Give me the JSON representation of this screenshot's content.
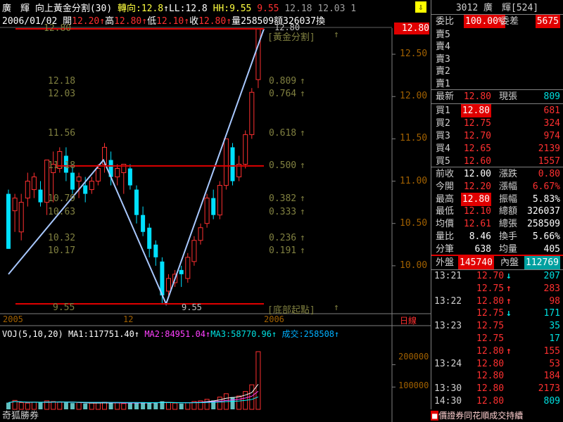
{
  "header": {
    "stock_name": "廣　輝",
    "indicator": "向上黃金分割(30)",
    "turn_label": "轉向:",
    "turn_value": "12.8",
    "ll_label": "↑LL:",
    "ll_value": "12.8",
    "hh_label": "HH:",
    "hh_value": "9.55",
    "level_a": "9.55",
    "level_b": "12.18",
    "level_c": "12.03",
    "level_d": "1",
    "date": "2006/01/02",
    "open_label": "開",
    "open": "12.20↑",
    "high_label": "高",
    "high": "12.80↑",
    "low_label": "低",
    "low": "12.10↑",
    "close_label": "收",
    "close": "12.80↑",
    "vol_label": "量",
    "vol": "258509",
    "amt_label": "額",
    "amt": "326037",
    "turnover_label": "換"
  },
  "price_axis": {
    "ticks": [
      "12.50",
      "12.00",
      "11.50",
      "11.00",
      "10.50",
      "10.00"
    ],
    "current_marker": "12.80"
  },
  "fib_labels": {
    "top": "12.80",
    "top_tag": "[黃金分割]",
    "bottom": "9.55",
    "bottom_tag": "[底部起點]",
    "arrow": "↑",
    "levels": [
      {
        "price": "12.18",
        "ratio": "0.809"
      },
      {
        "price": "12.03",
        "ratio": "0.764"
      },
      {
        "price": "11.56",
        "ratio": "0.618"
      },
      {
        "price": "11.18",
        "ratio": "0.500"
      },
      {
        "price": "10.79",
        "ratio": "0.382"
      },
      {
        "price": "10.63",
        "ratio": "0.333"
      },
      {
        "price": "10.32",
        "ratio": "0.236"
      },
      {
        "price": "10.17",
        "ratio": "0.191"
      }
    ],
    "right_arrows": [
      "↑",
      "↑",
      "↑",
      "↑",
      "↑",
      "↑",
      "↑",
      "↑"
    ]
  },
  "date_axis": {
    "left": "2005",
    "mid": "12",
    "right": "2006",
    "period": "日線"
  },
  "volume": {
    "title": "VOJ(5,10,20)",
    "ma1_label": "MA1:",
    "ma1": "117751.40↑",
    "ma2_label": "MA2:",
    "ma2": "84951.04↑",
    "ma3_label": "MA3:",
    "ma3": "58770.96↑",
    "deal_label": "成交:",
    "deal": "258508↑",
    "axis": [
      "200000",
      "100000"
    ],
    "watermark": "奇狐勝券"
  },
  "quote": {
    "code_name": "3012 廣　輝[524]",
    "wei_bi_label": "委比",
    "wei_bi": "100.00%",
    "wei_cha_label": "委差",
    "wei_cha": "5675",
    "sells": [
      "賣5",
      "賣4",
      "賣3",
      "賣2",
      "賣1"
    ],
    "last_label": "最新",
    "last": "12.80",
    "now_vol_label": "現張",
    "now_vol": "809",
    "buys": [
      {
        "label": "買1",
        "price": "12.80",
        "vol": "681"
      },
      {
        "label": "買2",
        "price": "12.75",
        "vol": "324"
      },
      {
        "label": "買3",
        "price": "12.70",
        "vol": "974"
      },
      {
        "label": "買4",
        "price": "12.65",
        "vol": "2139"
      },
      {
        "label": "買5",
        "price": "12.60",
        "vol": "1557"
      }
    ],
    "stats": [
      {
        "l1": "前收",
        "v1": "12.00",
        "l2": "漲跌",
        "v2": "0.80",
        "c1": "wht",
        "c2": "red"
      },
      {
        "l1": "今開",
        "v1": "12.20",
        "l2": "漲幅",
        "v2": "6.67%",
        "c1": "red",
        "c2": "red"
      },
      {
        "l1": "最高",
        "v1": "12.80",
        "l2": "振幅",
        "v2": "5.83%",
        "c1": "hl",
        "c2": "wht"
      },
      {
        "l1": "最低",
        "v1": "12.10",
        "l2": "總額",
        "v2": "326037",
        "c1": "red",
        "c2": "wht"
      },
      {
        "l1": "均價",
        "v1": "12.61",
        "l2": "總張",
        "v2": "258509",
        "c1": "red",
        "c2": "wht"
      },
      {
        "l1": "量比",
        "v1": "8.46",
        "l2": "換手",
        "v2": "5.66%",
        "c1": "wht",
        "c2": "wht"
      },
      {
        "l1": "分筆",
        "v1": "638",
        "l2": "均量",
        "v2": "405",
        "c1": "wht",
        "c2": "wht"
      }
    ],
    "outer_label": "外盤",
    "outer": "145740",
    "inner_label": "內盤",
    "inner": "112769",
    "ticks": [
      {
        "t": "13:21",
        "p": "12.70",
        "a": "↓",
        "v": "207",
        "pc": "red",
        "ac": "cyn",
        "vc": "cyn"
      },
      {
        "t": "",
        "p": "12.75",
        "a": "↑",
        "v": "283",
        "pc": "red",
        "ac": "red",
        "vc": "red"
      },
      {
        "t": "13:22",
        "p": "12.80",
        "a": "↑",
        "v": "98",
        "pc": "red",
        "ac": "red",
        "vc": "red"
      },
      {
        "t": "",
        "p": "12.75",
        "a": "↓",
        "v": "171",
        "pc": "red",
        "ac": "cyn",
        "vc": "cyn"
      },
      {
        "t": "13:23",
        "p": "12.75",
        "a": "",
        "v": "35",
        "pc": "red",
        "ac": "cyn",
        "vc": "cyn"
      },
      {
        "t": "",
        "p": "12.75",
        "a": "",
        "v": "17",
        "pc": "red",
        "ac": "cyn",
        "vc": "cyn"
      },
      {
        "t": "",
        "p": "12.80",
        "a": "↑",
        "v": "155",
        "pc": "red",
        "ac": "red",
        "vc": "red"
      },
      {
        "t": "13:24",
        "p": "12.80",
        "a": "",
        "v": "53",
        "pc": "red",
        "ac": "red",
        "vc": "red"
      },
      {
        "t": "",
        "p": "12.80",
        "a": "",
        "v": "184",
        "pc": "red",
        "ac": "red",
        "vc": "red"
      },
      {
        "t": "13:30",
        "p": "12.80",
        "a": "",
        "v": "2173",
        "pc": "red",
        "ac": "red",
        "vc": "red"
      },
      {
        "t": "14:30",
        "p": "12.80",
        "a": "",
        "v": "809",
        "pc": "red",
        "ac": "cyn",
        "vc": "cyn"
      }
    ]
  },
  "status_text": "價證券同花順成交持續",
  "colors": {
    "up": "#ff3030",
    "down": "#00e0ff",
    "fib": "#e00000",
    "zigzag": "#a8c8ff",
    "ma1": "#ffffff",
    "ma2": "#ff40ff",
    "ma3": "#00ffff"
  },
  "chart_data": {
    "type": "candlestick",
    "title": "向上黃金分割(30)",
    "x": [
      "2005 (Nov/Dec)",
      "...",
      "12",
      "...",
      "2006/01/02"
    ],
    "ylim": [
      9.3,
      12.9
    ],
    "price_ticks": [
      10.0,
      10.5,
      11.0,
      11.5,
      12.0,
      12.5
    ],
    "fib_low": 9.55,
    "fib_high": 12.8,
    "fib_levels": [
      {
        "ratio": 0.809,
        "price": 12.18
      },
      {
        "ratio": 0.764,
        "price": 12.03
      },
      {
        "ratio": 0.618,
        "price": 11.56
      },
      {
        "ratio": 0.5,
        "price": 11.18
      },
      {
        "ratio": 0.382,
        "price": 10.79
      },
      {
        "ratio": 0.333,
        "price": 10.63
      },
      {
        "ratio": 0.236,
        "price": 10.32
      },
      {
        "ratio": 0.191,
        "price": 10.17
      }
    ],
    "candles": [
      [
        10.85,
        10.2,
        10.9,
        10.2
      ],
      [
        10.65,
        10.8,
        10.85,
        10.4
      ],
      [
        10.4,
        10.75,
        10.85,
        10.3
      ],
      [
        10.8,
        11.0,
        11.1,
        10.7
      ],
      [
        10.9,
        11.05,
        11.1,
        10.8
      ],
      [
        10.9,
        10.75,
        11.0,
        10.7
      ],
      [
        10.75,
        11.25,
        11.25,
        10.6
      ],
      [
        11.1,
        11.2,
        11.35,
        10.75
      ],
      [
        11.15,
        11.35,
        11.4,
        11.1
      ],
      [
        11.3,
        11.1,
        11.4,
        11.0
      ],
      [
        11.1,
        10.9,
        11.2,
        10.85
      ],
      [
        11.0,
        11.05,
        11.1,
        10.8
      ],
      [
        10.95,
        10.85,
        11.05,
        10.75
      ],
      [
        10.9,
        11.0,
        11.05,
        10.85
      ],
      [
        11.0,
        11.15,
        11.2,
        10.95
      ],
      [
        11.2,
        11.4,
        11.45,
        11.1
      ],
      [
        11.25,
        11.05,
        11.35,
        10.95
      ],
      [
        11.05,
        11.15,
        11.2,
        10.95
      ],
      [
        11.1,
        11.2,
        11.2,
        10.85
      ],
      [
        11.15,
        10.95,
        11.2,
        10.9
      ],
      [
        10.9,
        10.6,
        10.95,
        10.5
      ],
      [
        10.6,
        10.4,
        10.7,
        10.35
      ],
      [
        10.45,
        10.2,
        10.5,
        10.1
      ],
      [
        10.25,
        10.1,
        10.3,
        10.0
      ],
      [
        10.05,
        9.65,
        10.1,
        9.55
      ],
      [
        9.7,
        9.85,
        9.9,
        9.65
      ],
      [
        9.8,
        9.9,
        9.95,
        9.75
      ],
      [
        9.95,
        9.9,
        10.0,
        9.75
      ],
      [
        9.85,
        10.1,
        10.15,
        9.8
      ],
      [
        10.05,
        10.3,
        10.35,
        10.0
      ],
      [
        10.3,
        10.45,
        10.5,
        10.25
      ],
      [
        10.5,
        10.8,
        10.85,
        10.45
      ],
      [
        10.8,
        10.6,
        10.9,
        10.55
      ],
      [
        10.6,
        10.95,
        11.0,
        10.55
      ],
      [
        10.95,
        11.5,
        11.5,
        10.9
      ],
      [
        11.4,
        11.0,
        11.45,
        10.95
      ],
      [
        11.05,
        11.2,
        11.3,
        11.0
      ],
      [
        11.2,
        11.55,
        11.6,
        11.15
      ],
      [
        11.55,
        12.05,
        12.1,
        11.5
      ],
      [
        12.2,
        12.8,
        12.8,
        12.1
      ]
    ],
    "volume": [
      30000,
      40000,
      30000,
      28000,
      32000,
      30000,
      38000,
      35000,
      32000,
      30000,
      28000,
      30000,
      26000,
      28000,
      30000,
      32000,
      28000,
      30000,
      26000,
      28000,
      30000,
      32000,
      28000,
      30000,
      36000,
      30000,
      28000,
      26000,
      30000,
      35000,
      38000,
      45000,
      40000,
      55000,
      70000,
      55000,
      60000,
      80000,
      110000,
      258509
    ],
    "volume_ticks": [
      100000,
      200000
    ]
  }
}
